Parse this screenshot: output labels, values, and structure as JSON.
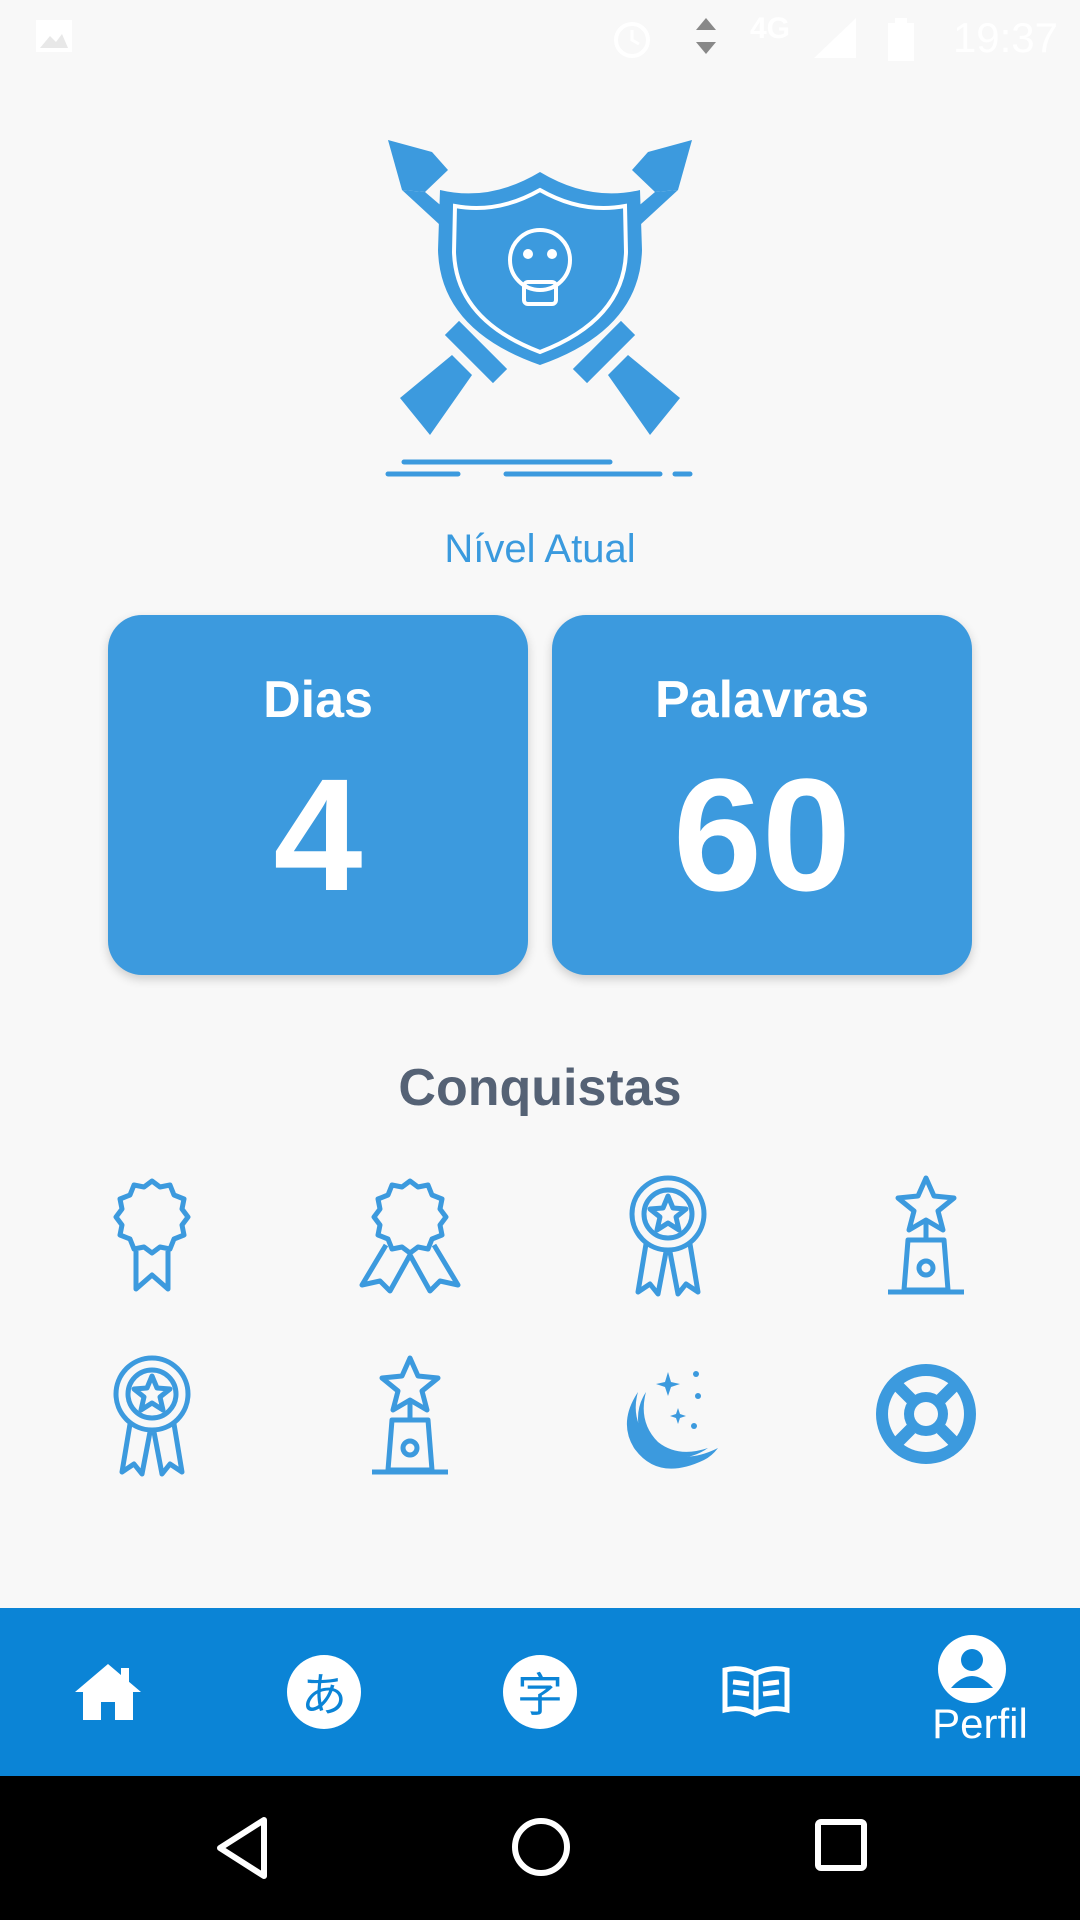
{
  "status_bar": {
    "time": "19:37",
    "network": "4G"
  },
  "level": {
    "label": "Nível Atual"
  },
  "stats": [
    {
      "title": "Dias",
      "value": "4"
    },
    {
      "title": "Palavras",
      "value": "60"
    }
  ],
  "achievements": {
    "title": "Conquistas",
    "icons": [
      "medal-ribbon-icon",
      "double-ribbon-medal-icon",
      "star-medal-icon",
      "star-trophy-icon",
      "star-medal-icon",
      "star-trophy-icon",
      "moon-stars-icon",
      "lifebuoy-icon"
    ]
  },
  "bottom_nav": {
    "items": [
      {
        "icon": "home-icon"
      },
      {
        "icon": "hiragana-icon",
        "glyph": "あ"
      },
      {
        "icon": "kanji-icon",
        "glyph": "字"
      },
      {
        "icon": "book-icon"
      },
      {
        "icon": "profile-icon",
        "label": "Perfil"
      }
    ]
  },
  "colors": {
    "accent": "#3c9ade",
    "nav": "#0b84d6",
    "title": "#556275",
    "background": "#f8f8f8"
  }
}
